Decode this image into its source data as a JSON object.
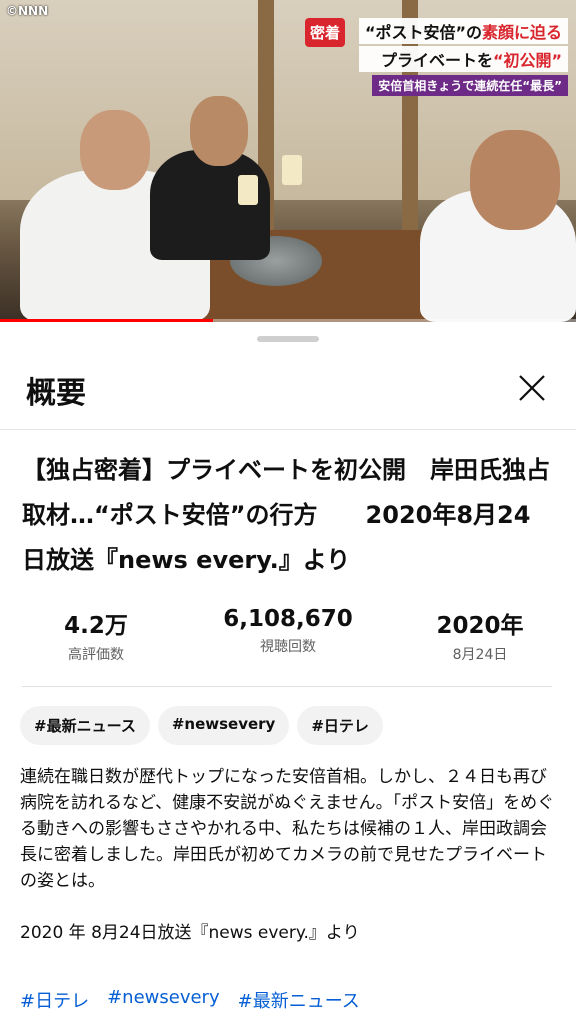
{
  "video": {
    "logo": "©NNN",
    "caption_tag": "密着",
    "caption_line1_pre": "“ポスト安倍”の",
    "caption_line1_red": "素顔に迫る",
    "caption_line2_pre": "プライベートを",
    "caption_line2_red": "“初公開”",
    "caption_line3": "安倍首相きょうで連続在任“最長”",
    "progress": 0.37
  },
  "sheet": {
    "title": "概要",
    "video_title": "【独占密着】プライベートを初公開　岸田氏独占取材…“ポスト安倍”の行方　　2020年8月24日放送『news every.』より",
    "stats": [
      {
        "value": "4.2万",
        "label": "高評価数"
      },
      {
        "value": "6,108,670",
        "label": "視聴回数"
      },
      {
        "value": "2020年",
        "label": "8月24日"
      }
    ],
    "chips": [
      "#最新ニュース",
      "#newsevery",
      "#日テレ"
    ],
    "description": "連続在職日数が歴代トップになった安倍首相。しかし、２４日も再び病院を訪れるなど、健康不安説がぬぐえません。「ポスト安倍」をめぐる動きへの影響もささやかれる中、私たちは候補の１人、岸田政調会長に密着しました。岸田氏が初めてカメラの前で見せたプライベートの姿とは。",
    "broadcast": "2020 年 8月24日放送『news every.』より",
    "hashtags": [
      "#日テレ",
      "#newsevery",
      "#最新ニュース"
    ]
  },
  "colors": {
    "accent": "#065fd4",
    "caption_red": "#d9262e",
    "progress": "#ff0000"
  }
}
